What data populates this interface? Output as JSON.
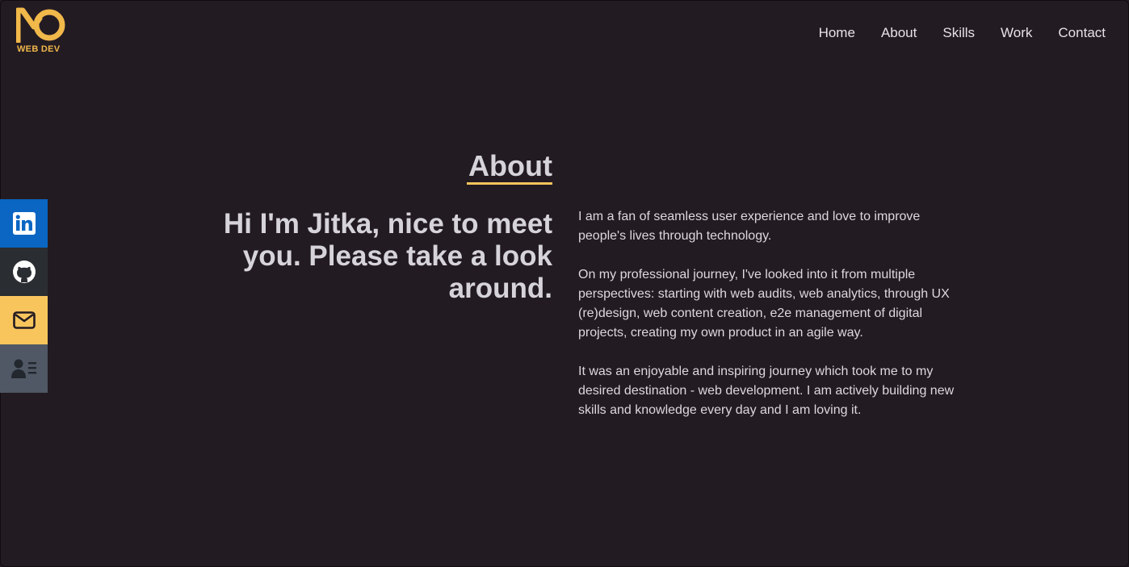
{
  "brand": {
    "logo_text": "WEB DEV",
    "accent_color": "#f8c55d"
  },
  "nav": {
    "items": [
      {
        "label": "Home"
      },
      {
        "label": "About"
      },
      {
        "label": "Skills"
      },
      {
        "label": "Work"
      },
      {
        "label": "Contact"
      }
    ]
  },
  "social": [
    {
      "icon": "linkedin-icon",
      "color": "#0a66c2"
    },
    {
      "icon": "github-icon",
      "color": "#2a2d31"
    },
    {
      "icon": "mail-icon",
      "color": "#f8c55d"
    },
    {
      "icon": "resume-icon",
      "color": "#4f5864"
    }
  ],
  "about": {
    "title": "About",
    "intro": "Hi I'm Jitka, nice to meet you. Please take a look around.",
    "paragraphs": [
      "I am a fan of seamless user experience and love to improve people's lives through technology.",
      "On my professional journey, I've looked into it from multiple perspectives: starting with web audits, web analytics, through UX (re)design, web content creation, e2e management of digital projects, creating my own product in an agile way.",
      "It was an enjoyable and inspiring journey which took me to my desired destination - web development. I am actively building new skills and knowledge every day and I am loving it."
    ]
  }
}
